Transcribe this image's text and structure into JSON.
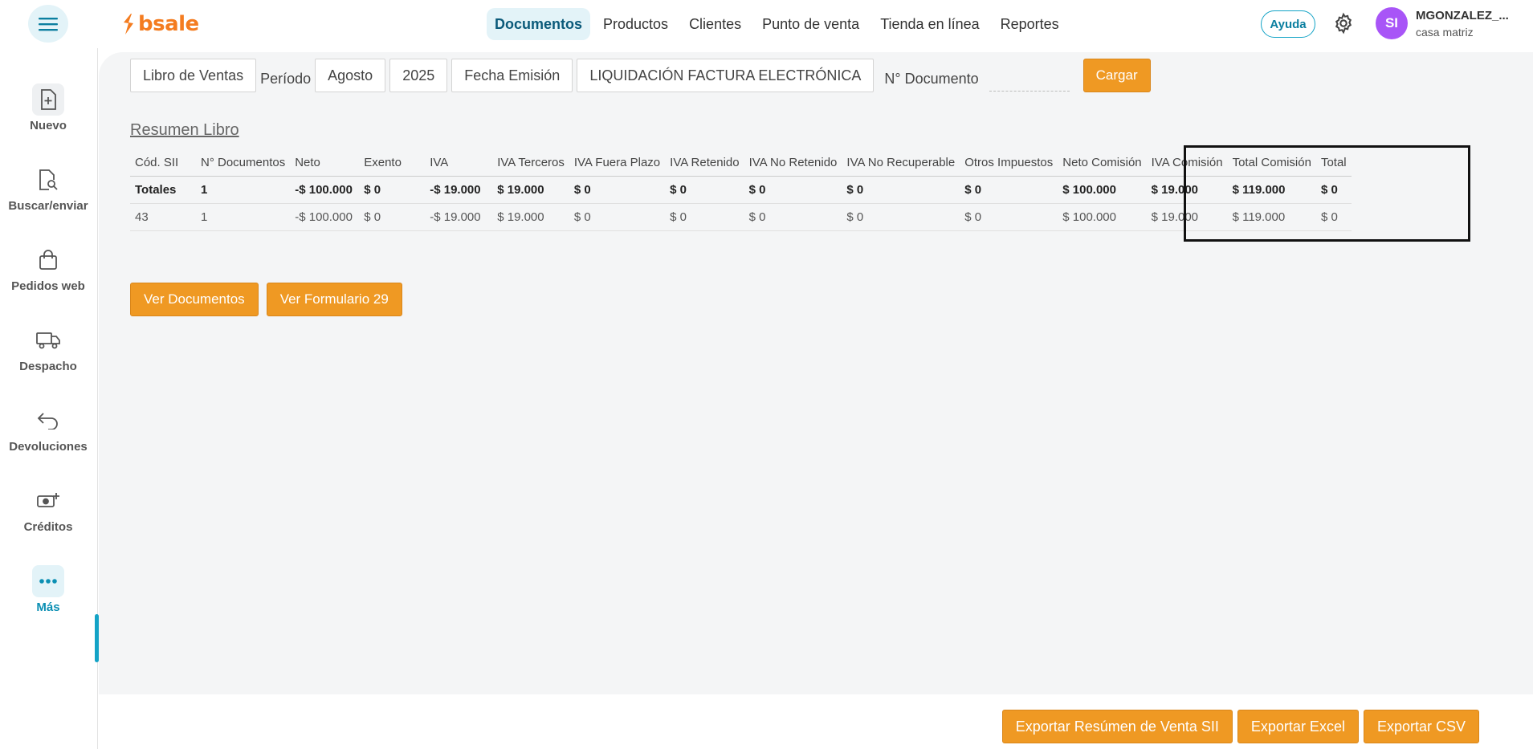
{
  "brand": {
    "name": "bsale",
    "color": "#f47c20"
  },
  "nav": {
    "items": [
      "Documentos",
      "Productos",
      "Clientes",
      "Punto de venta",
      "Tienda en línea",
      "Reportes"
    ],
    "active": "Documentos"
  },
  "header": {
    "help_label": "Ayuda",
    "avatar_initials": "SI",
    "user_name": "MGONZALEZ_...",
    "branch": "casa matriz"
  },
  "sidebar": {
    "items": [
      {
        "label": "Nuevo",
        "icon": "file-plus-icon"
      },
      {
        "label": "Buscar/enviar",
        "icon": "file-search-icon"
      },
      {
        "label": "Pedidos web",
        "icon": "shopping-bag-icon"
      },
      {
        "label": "Despacho",
        "icon": "truck-icon"
      },
      {
        "label": "Devoluciones",
        "icon": "return-arrow-icon"
      },
      {
        "label": "Créditos",
        "icon": "cash-plus-icon"
      },
      {
        "label": "Más",
        "icon": "more-dots-icon"
      }
    ],
    "active": "Más"
  },
  "filters": {
    "book": "Libro de Ventas",
    "period_label": "Período",
    "month": "Agosto",
    "year": "2025",
    "date_type": "Fecha Emisión",
    "doc_type": "LIQUIDACIÓN FACTURA ELECTRÓNICA",
    "doc_number_label": "N° Documento",
    "doc_number_value": "",
    "load_button": "Cargar"
  },
  "summary": {
    "title": "Resumen Libro",
    "columns": [
      "Cód. SII",
      "N° Documentos",
      "Neto",
      "Exento",
      "IVA",
      "IVA Terceros",
      "IVA Fuera Plazo",
      "IVA Retenido",
      "IVA No Retenido",
      "IVA No Recuperable",
      "Otros Impuestos",
      "Neto Comisión",
      "IVA Comisión",
      "Total Comisión",
      "Total"
    ],
    "totals": [
      "Totales",
      "1",
      "-$ 100.000",
      "$ 0",
      "-$ 19.000",
      "$ 19.000",
      "$ 0",
      "$ 0",
      "$ 0",
      "$ 0",
      "$ 0",
      "$ 100.000",
      "$ 19.000",
      "$ 119.000",
      "$ 0"
    ],
    "rows": [
      [
        "43",
        "1",
        "-$ 100.000",
        "$ 0",
        "-$ 19.000",
        "$ 19.000",
        "$ 0",
        "$ 0",
        "$ 0",
        "$ 0",
        "$ 0",
        "$ 100.000",
        "$ 19.000",
        "$ 119.000",
        "$ 0"
      ]
    ]
  },
  "actions": {
    "view_documents": "Ver Documentos",
    "view_form": "Ver Formulario 29"
  },
  "exports": {
    "sii": "Exportar Resúmen de Venta SII",
    "excel": "Exportar Excel",
    "csv": "Exportar CSV"
  },
  "colors": {
    "accent": "#ef9923",
    "nav_active_bg": "#e3f3f8",
    "nav_active_text": "#0b5a7a",
    "side_active": "#13a3c6"
  }
}
